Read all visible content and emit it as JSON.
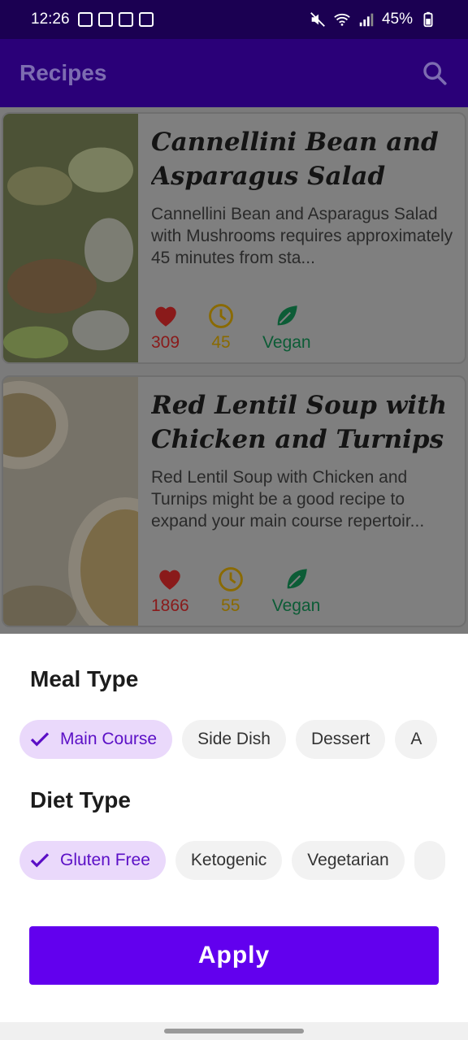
{
  "status": {
    "time": "12:26",
    "battery": "45%"
  },
  "appbar": {
    "title": "Recipes"
  },
  "recipes": [
    {
      "title": "Cannellini Bean and Asparagus Salad with ...",
      "description": "Cannellini Bean and Asparagus Salad with Mushrooms requires approximately 45 minutes from sta...",
      "likes": "309",
      "minutes": "45",
      "diet": "Vegan"
    },
    {
      "title": "Red Lentil Soup with Chicken and Turnips",
      "description": "Red Lentil Soup with Chicken and Turnips might be a good recipe to expand your main course repertoir...",
      "likes": "1866",
      "minutes": "55",
      "diet": "Vegan"
    }
  ],
  "sheet": {
    "meal_title": "Meal Type",
    "meal_chips": [
      "Main Course",
      "Side Dish",
      "Dessert",
      "A"
    ],
    "diet_title": "Diet Type",
    "diet_chips": [
      "Gluten Free",
      "Ketogenic",
      "Vegetarian",
      ""
    ],
    "apply_label": "Apply"
  },
  "colors": {
    "accent": "#6200ee",
    "appbar": "#2a0078",
    "chip_selected": "#ead9fb"
  }
}
